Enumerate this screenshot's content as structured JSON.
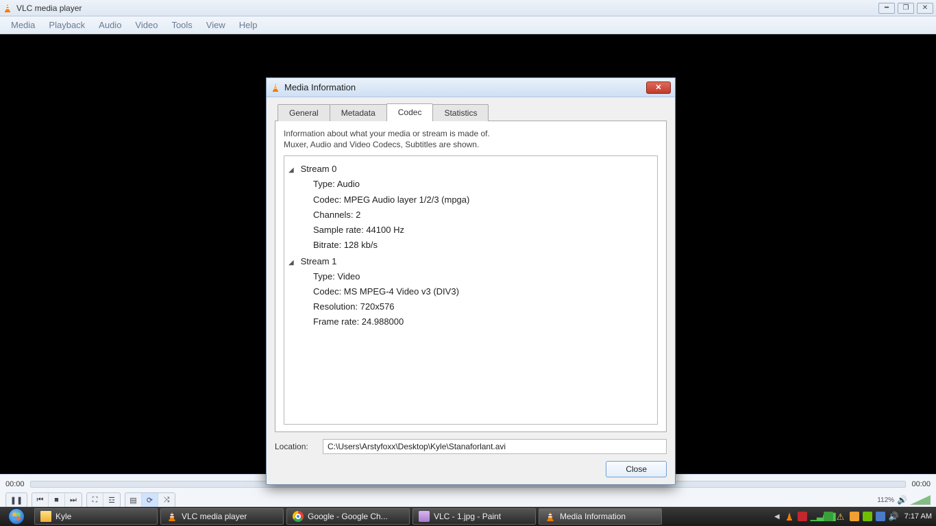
{
  "window": {
    "title": "VLC media player",
    "menus": [
      "Media",
      "Playback",
      "Audio",
      "Video",
      "Tools",
      "View",
      "Help"
    ]
  },
  "seek": {
    "start": "00:00",
    "end": "00:00"
  },
  "volume": {
    "percent": "112%"
  },
  "dialog": {
    "title": "Media Information",
    "tabs": [
      "General",
      "Metadata",
      "Codec",
      "Statistics"
    ],
    "active_tab": "Codec",
    "hint_line1": "Information about what your media or stream is made of.",
    "hint_line2": "Muxer, Audio and Video Codecs, Subtitles are shown.",
    "streams": [
      {
        "name": "Stream 0",
        "props": [
          "Type: Audio",
          "Codec: MPEG Audio layer 1/2/3 (mpga)",
          "Channels: 2",
          "Sample rate: 44100 Hz",
          "Bitrate: 128 kb/s"
        ]
      },
      {
        "name": "Stream 1",
        "props": [
          "Type: Video",
          "Codec: MS MPEG-4 Video v3 (DIV3)",
          "Resolution: 720x576",
          "Frame rate: 24.988000"
        ]
      }
    ],
    "location_label": "Location:",
    "location_value": "C:\\Users\\Arstyfoxx\\Desktop\\Kyle\\Stanaforlant.avi",
    "close_label": "Close"
  },
  "taskbar": {
    "items": [
      {
        "label": "Kyle",
        "icon": "folder"
      },
      {
        "label": "VLC media player",
        "icon": "vlc"
      },
      {
        "label": "Google - Google Ch...",
        "icon": "chrome"
      },
      {
        "label": "VLC - 1.jpg - Paint",
        "icon": "paint"
      },
      {
        "label": "Media Information",
        "icon": "vlc",
        "active": true
      }
    ],
    "clock": "7:17 AM"
  }
}
